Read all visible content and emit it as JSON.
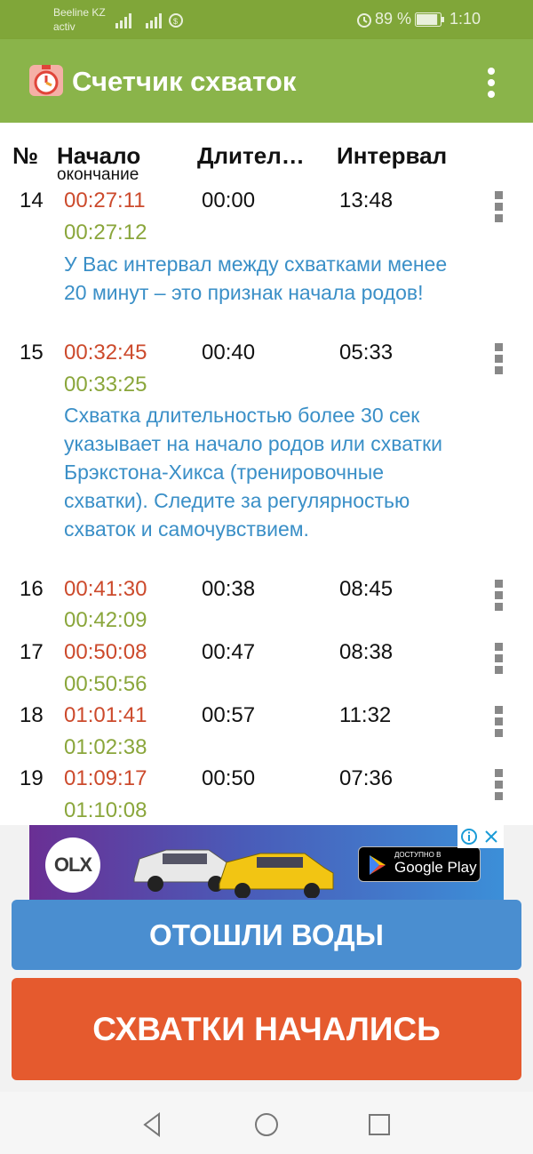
{
  "status_bar": {
    "carrier_line1": "Beeline KZ",
    "carrier_line2": "activ",
    "battery_percent": "89 %",
    "time": "1:10",
    "battery_level": 0.89
  },
  "app_bar": {
    "title": "Счетчик схваток",
    "logo_icon": "stopwatch-icon",
    "menu_icon": "more-vert-icon",
    "color": "#8ab44a"
  },
  "table": {
    "headers": {
      "num": "№",
      "start": "Начало",
      "start_sub": "окончание",
      "duration": "Длител…",
      "interval": "Интервал"
    },
    "rows": [
      {
        "num": "14",
        "start": "00:27:11",
        "end": "00:27:12",
        "duration": "00:00",
        "interval": "13:48",
        "note": "У Вас интервал между схватками менее 20 минут – это признак начала родов!"
      },
      {
        "num": "15",
        "start": "00:32:45",
        "end": "00:33:25",
        "duration": "00:40",
        "interval": "05:33",
        "note": "Схватка длительностью более 30 сек указывает на начало родов или схватки Брэкстона-Хикса (тренировочные схватки). Следите за регулярностью схваток и самочувствием."
      },
      {
        "num": "16",
        "start": "00:41:30",
        "end": "00:42:09",
        "duration": "00:38",
        "interval": "08:45"
      },
      {
        "num": "17",
        "start": "00:50:08",
        "end": "00:50:56",
        "duration": "00:47",
        "interval": "08:38"
      },
      {
        "num": "18",
        "start": "01:01:41",
        "end": "01:02:38",
        "duration": "00:57",
        "interval": "11:32"
      },
      {
        "num": "19",
        "start": "01:09:17",
        "end": "01:10:08",
        "duration": "00:50",
        "interval": "07:36"
      }
    ]
  },
  "ad": {
    "brand": "OLX",
    "store_small": "ДОСТУПНО В",
    "store_big": "Google Play"
  },
  "buttons": {
    "waters": "ОТОШЛИ ВОДЫ",
    "contractions": "СХВАТКИ НАЧАЛИСЬ"
  },
  "colors": {
    "start_time": "#cc4a2c",
    "end_time": "#8aa63b",
    "note": "#3a8fc7",
    "waters_button": "#4a8ed0",
    "contractions_button": "#e55a2e"
  }
}
